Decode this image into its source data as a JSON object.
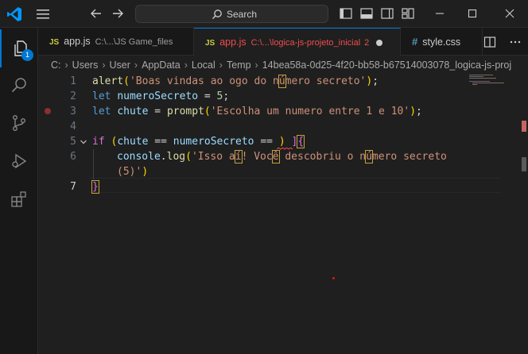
{
  "titlebar": {
    "search_label": "Search"
  },
  "activity": {
    "explorer_badge": "1"
  },
  "tabs": [
    {
      "lang": "JS",
      "name": "app.js",
      "path": "C:\\...\\JS Game_files"
    },
    {
      "lang": "JS",
      "name": "app.js",
      "path": "C:\\...\\logica-js-projeto_inicial",
      "problems": "2"
    },
    {
      "lang": "#",
      "name": "style.css"
    }
  ],
  "breadcrumb": [
    "C:",
    "Users",
    "User",
    "AppData",
    "Local",
    "Temp",
    "14bea58a-0d25-4f20-bb58-b67514003078_logica-js-proj"
  ],
  "editor": {
    "line_numbers": [
      "1",
      "2",
      "3",
      "4",
      "5",
      "6",
      "",
      "7"
    ],
    "line1": {
      "fn": "alert",
      "str_a": "'Boas vindas ao ogo do n",
      "str_hl": "ú",
      "str_b": "mero secreto'"
    },
    "line2": {
      "kw": "let",
      "var": "numeroSecreto",
      "op": " = ",
      "num": "5"
    },
    "line3": {
      "kw": "let",
      "var": "chute",
      "op": " = ",
      "fn": "prompt",
      "str": "'Escolha um numero entre 1 e 10'"
    },
    "line5": {
      "kw": "if",
      "var1": "chute",
      "op1": " == ",
      "var2": "numeroSecreto",
      "op2": " == "
    },
    "line6": {
      "obj": "console",
      "fn": "log",
      "str_a": "'Isso a",
      "hl1": "í",
      "str_b": "! Voc",
      "hl2": "ê",
      "str_c": " descobriu o n",
      "hl3": "ú",
      "str_d": "mero secreto"
    },
    "line6_wrap": "(5)'",
    "line7": "}"
  },
  "colors": {
    "accent": "#0078d4",
    "error": "#f14c4c",
    "keyword": "#569cd6",
    "string": "#ce9178",
    "function": "#dcdcaa",
    "variable": "#9cdcfe",
    "number": "#b5cea8"
  }
}
